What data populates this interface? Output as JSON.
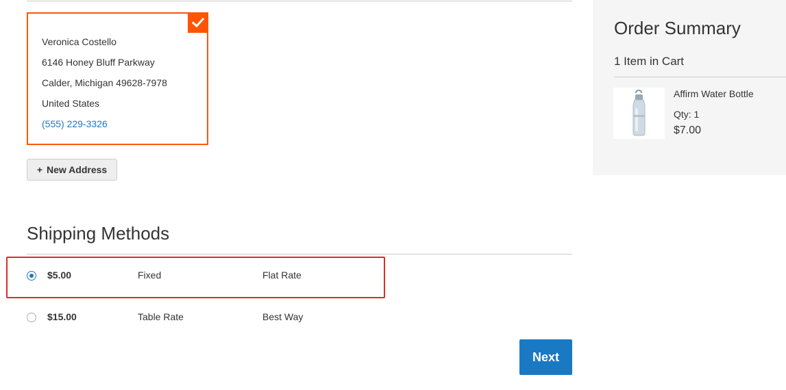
{
  "address": {
    "name": "Veronica Costello",
    "street": "6146 Honey Bluff Parkway",
    "city_line": "Calder, Michigan 49628-7978",
    "country": "United States",
    "phone": "(555) 229-3326"
  },
  "new_address": {
    "icon": "+",
    "label": "New Address"
  },
  "shipping": {
    "title": "Shipping Methods",
    "methods": [
      {
        "price": "$5.00",
        "method": "Fixed",
        "carrier": "Flat Rate",
        "selected": true
      },
      {
        "price": "$15.00",
        "method": "Table Rate",
        "carrier": "Best Way",
        "selected": false
      }
    ]
  },
  "next_label": "Next",
  "summary": {
    "title": "Order Summary",
    "count": "1 Item in Cart",
    "item": {
      "name": "Affirm Water Bottle",
      "qty": "Qty: 1",
      "price": "$7.00"
    }
  },
  "colors": {
    "accent": "#ff5501",
    "primary": "#1979c3",
    "highlight": "#e02b27"
  }
}
